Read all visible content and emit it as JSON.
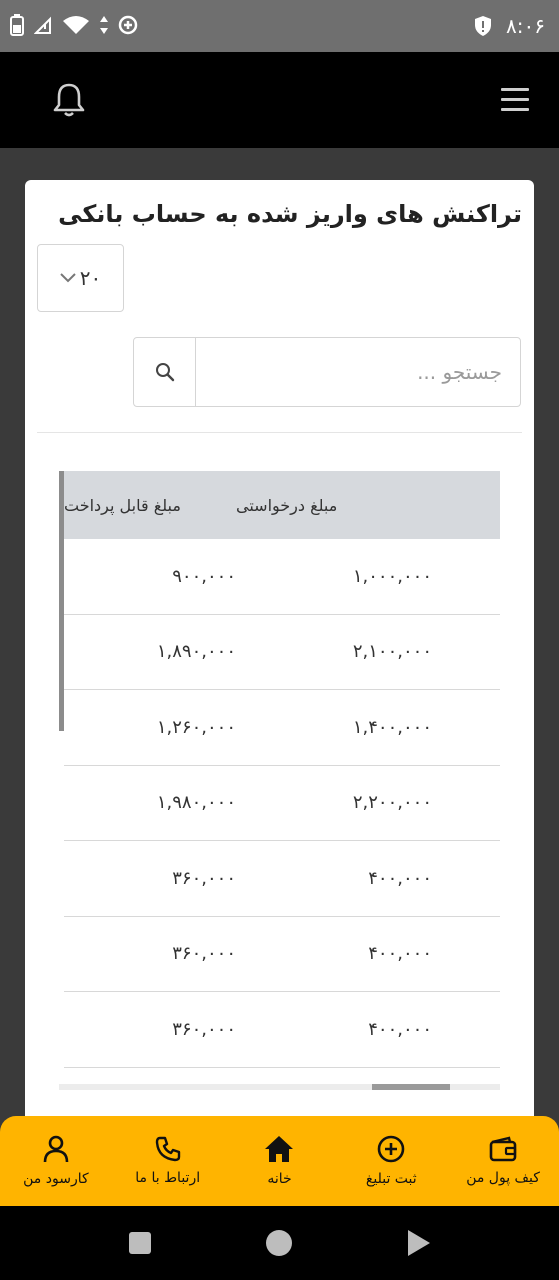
{
  "status": {
    "time": "۸:۰۶"
  },
  "page": {
    "title": "تراکنش های واریز شده به حساب بانکی"
  },
  "controls": {
    "per_page": "۲۰",
    "search_placeholder": "جستجو ..."
  },
  "table": {
    "headers": {
      "requested": "مبلغ درخواستی",
      "payable": "مبلغ قابل پرداخت"
    },
    "rows": [
      {
        "requested": "۱,۰۰۰,۰۰۰",
        "payable": "۹۰۰,۰۰۰"
      },
      {
        "requested": "۲,۱۰۰,۰۰۰",
        "payable": "۱,۸۹۰,۰۰۰"
      },
      {
        "requested": "۱,۴۰۰,۰۰۰",
        "payable": "۱,۲۶۰,۰۰۰"
      },
      {
        "requested": "۲,۲۰۰,۰۰۰",
        "payable": "۱,۹۸۰,۰۰۰"
      },
      {
        "requested": "۴۰۰,۰۰۰",
        "payable": "۳۶۰,۰۰۰"
      },
      {
        "requested": "۴۰۰,۰۰۰",
        "payable": "۳۶۰,۰۰۰"
      },
      {
        "requested": "۴۰۰,۰۰۰",
        "payable": "۳۶۰,۰۰۰"
      }
    ]
  },
  "bottom_nav": {
    "items": [
      {
        "label": "کارسود من",
        "icon": "user-icon"
      },
      {
        "label": "ارتباط با ما",
        "icon": "phone-icon"
      },
      {
        "label": "خانه",
        "icon": "home-icon"
      },
      {
        "label": "ثبت تبلیغ",
        "icon": "plus-circle-icon"
      },
      {
        "label": "کیف پول من",
        "icon": "wallet-icon"
      }
    ]
  },
  "colors": {
    "accent": "#ffb400",
    "header_bg": "#000000",
    "status_bg": "#6f6f6f"
  }
}
